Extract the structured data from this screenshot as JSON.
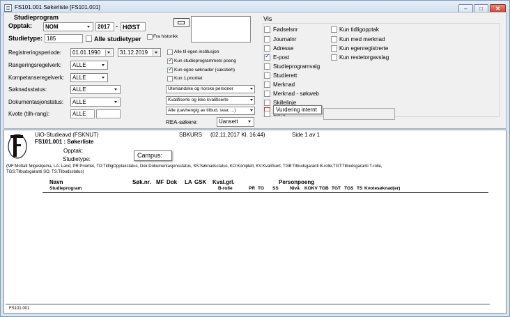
{
  "window": {
    "title": "FS101.001 Søkerliste [FS101.001]",
    "min_label": "–",
    "max_label": "□",
    "close_label": "✕"
  },
  "studieprogram": {
    "heading": "Studieprogram",
    "opptak_label": "Opptak:",
    "opptak_value": "NOM",
    "year": "2017",
    "dash": "-",
    "term": "HØST",
    "studietype_label": "Studietype:",
    "studietype_value": "185",
    "alle_studietyper": "Alle studietyper",
    "fra_historikk": "Fra historikk"
  },
  "filters": {
    "registreringsperiode_label": "Registreringsperiode:",
    "date_from": "01.01.1990",
    "date_to": "31.12.2019",
    "rangeringsregelverk_label": "Rangeringsregelverk:",
    "rangeringsregelverk_value": "ALLE",
    "kompetanseregelverk_label": "Kompetanseregelverk:",
    "kompetanseregelverk_value": "ALLE",
    "soknadsstatus_label": "Søknadsstatus:",
    "soknadsstatus_value": "ALLE",
    "dokumentasjonsstatus_label": "Dokumentasjonstatus:",
    "dokumentasjonsstatus_value": "ALLE",
    "kvote_label": "Kvote (tilh-rang):",
    "kvote_value": "ALLE",
    "kvote_value2": ""
  },
  "middle": {
    "checks": [
      {
        "label": "Alle til egen institusjon",
        "checked": false
      },
      {
        "label": "Kun studieprogrammets poeng",
        "checked": true
      },
      {
        "label": "Kun egne søknader (saksbeh)",
        "checked": true
      },
      {
        "label": "Kun 1.prioritet",
        "checked": false
      }
    ],
    "dropdowns": [
      "Utenlandske og norske personer",
      "Kvalifiserte og ikke kvalifiserte",
      "Alle (uavhengig av tilbud, svar, ...)"
    ],
    "rea_label": "REA-søkere:",
    "rea_value": "Uansett"
  },
  "vis": {
    "heading": "Vis",
    "col1": [
      {
        "label": "Fødselsnr",
        "checked": false
      },
      {
        "label": "Journalnr",
        "checked": false
      },
      {
        "label": "Adresse",
        "checked": false
      },
      {
        "label": "E-post",
        "checked": true
      },
      {
        "label": "Studieprogramvalg",
        "checked": false
      },
      {
        "label": "Studierett",
        "checked": false
      },
      {
        "label": "Merknad",
        "checked": false
      },
      {
        "label": "Merknad - søkweb",
        "checked": false
      },
      {
        "label": "Skillelinje",
        "checked": false
      },
      {
        "label": "Land",
        "checked": false
      }
    ],
    "col2": [
      {
        "label": "Kun tidligopptak",
        "checked": false
      },
      {
        "label": "Kun med merknad",
        "checked": false
      },
      {
        "label": "Kun egenregistrerte",
        "checked": false
      },
      {
        "label": "Kun restetorgavslag",
        "checked": false
      }
    ],
    "tooltip": "Vurdering internt"
  },
  "report": {
    "org": "UiO-Studieavd (FSKNUT)",
    "code_title": "FS101.001 : Søkerliste",
    "sbkurs": "SBKURS",
    "timestamp": "(02.11.2017 Kl. 16:44)",
    "page": "Side 1 av 1",
    "opptak_label": "Opptak:",
    "studietype_label": "Studietype:",
    "campus_label": "Campus:",
    "legend1": "(MF:Mottatt følgeskjema, LA: Land, PR:Prioritet, TO:TidligOpptakstatus, Dok:Dokumentasjonsstatus, SS:Søknadsstatus, KO:Komplett, KV:Kvalifisert, TGB:Tilbudsgaranti B-rolle,TGT:Tilbudsgaranti T-rolle,",
    "legend2": "TGS:Tilbudsgaranti SO, TS:Tilbudsstatus)",
    "col_navn": "Navn",
    "col_studieprogram": "Studieprogram",
    "col_soknr": "Søk.nr.",
    "col_mf": "MF",
    "col_dok": "Dok",
    "col_la": "LA",
    "col_gsk": "GSK",
    "col_kvalgrl": "Kval.grl.",
    "col_brolle": "B-rolle",
    "col_personpoeng": "Personpoeng",
    "col_pr": "PR",
    "col_to": "TO",
    "col_ss": "SS",
    "col_niva": "Nivå",
    "col_kokv": "KOKV",
    "col_tgb": "TGB",
    "col_tgt": "TGT",
    "col_tgs": "TGS",
    "col_ts": "TS",
    "col_kvotesoknad": "Kvotesøknad(er)",
    "footer": "FS101.001"
  }
}
